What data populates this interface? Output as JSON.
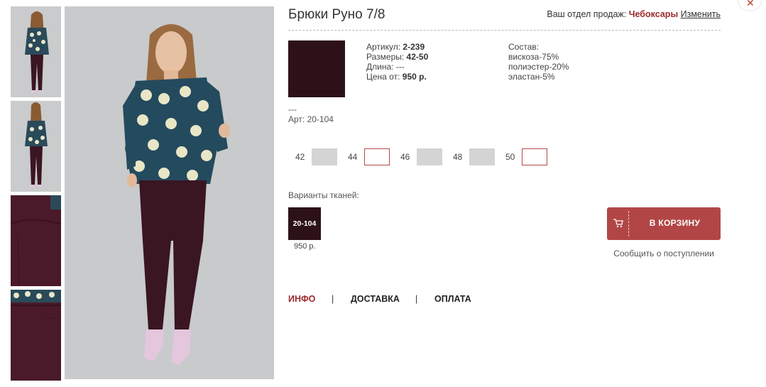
{
  "product": {
    "title": "Брюки Руно 7/8",
    "swatch_color": "#2c1118",
    "article_label": "Артикул:",
    "article_value": "2-239",
    "sizes_label": "Размеры:",
    "sizes_value": "42-50",
    "length_label": "Длина:",
    "length_value": "---",
    "price_label": "Цена от:",
    "price_value": "950 р.",
    "composition_title": "Состав:",
    "composition": [
      "вискоза-75%",
      "полиэстер-20%",
      "эластан-5%"
    ],
    "dash": "---",
    "art_note": "Арт: 20-104"
  },
  "department": {
    "label": "Ваш отдел продаж:",
    "city": "Чебоксары",
    "change": "Изменить"
  },
  "sizes": [
    {
      "num": "42",
      "available": false
    },
    {
      "num": "44",
      "available": true
    },
    {
      "num": "46",
      "available": false
    },
    {
      "num": "48",
      "available": false
    },
    {
      "num": "50",
      "available": true
    }
  ],
  "fabrics": {
    "label": "Варианты тканей:",
    "items": [
      {
        "code": "20-104",
        "price": "950 р.",
        "color": "#2c1118"
      }
    ]
  },
  "cart": {
    "button_label": "В КОРЗИНУ",
    "notify_label": "Сообщить о поступлении",
    "color": "#b24646"
  },
  "tabs": [
    {
      "label": "ИНФО",
      "active": true
    },
    {
      "label": "ДОСТАВКА",
      "active": false
    },
    {
      "label": "ОПЛАТА",
      "active": false
    }
  ],
  "tab_separator": "|",
  "close_glyph": "✕",
  "accent_color": "#9a2b2b"
}
